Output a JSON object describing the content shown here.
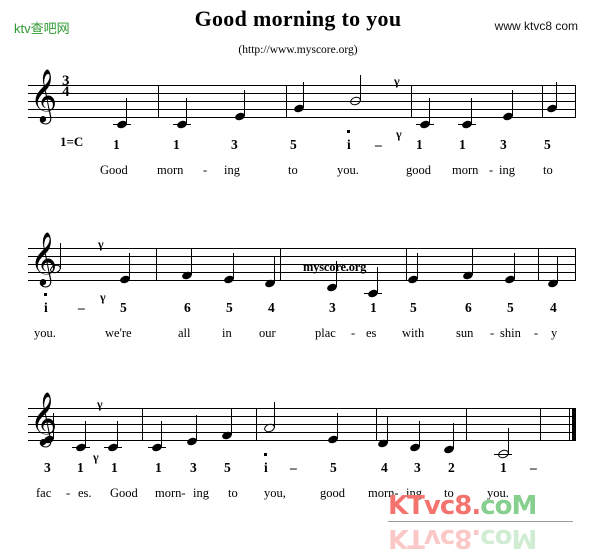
{
  "header": {
    "site_logo": "ktv查吧网",
    "title": "Good morning to you",
    "site_url": "www ktvc8 com",
    "subtitle": "(http://www.myscore.org)"
  },
  "score": {
    "clef_glyph": "𝄞",
    "time_signature_top": "3",
    "time_signature_bottom": "4",
    "key_label": "1=C",
    "watermark_staff": "myscore.org",
    "breath_mark": "γ",
    "dash": "–"
  },
  "watermark_bottom": {
    "part_red": "KTvc8.",
    "part_green": "coM"
  },
  "systems": [
    {
      "index": 1,
      "numbers": [
        "1",
        "1",
        "3",
        "5",
        "i",
        "–",
        "1",
        "1",
        "3",
        "5"
      ],
      "lyrics": [
        "Good",
        "morn",
        "-",
        "ing",
        "to",
        "you.",
        "good",
        "morn",
        "-",
        "ing",
        "to"
      ]
    },
    {
      "index": 2,
      "numbers": [
        "i",
        "–",
        "5",
        "6",
        "5",
        "4",
        "3",
        "1",
        "5",
        "6",
        "5",
        "4"
      ],
      "lyrics": [
        "you.",
        "we're",
        "all",
        "in",
        "our",
        "plac",
        "-",
        "es",
        "with",
        "sun",
        "-",
        "shin",
        "-",
        "y"
      ]
    },
    {
      "index": 3,
      "numbers": [
        "3",
        "1",
        "1",
        "1",
        "3",
        "5",
        "i",
        "–",
        "5",
        "4",
        "3",
        "2",
        "1",
        "–"
      ],
      "lyrics": [
        "fac",
        "-",
        "es.",
        "Good",
        "morn-",
        "ing",
        "to",
        "you,",
        "good",
        "morn-",
        "ing",
        "to",
        "you."
      ]
    }
  ],
  "chart_data": {
    "type": "table",
    "title": "Good morning to you",
    "key": "1=C",
    "time_signature": "3/4",
    "staves": [
      {
        "system": 1,
        "notes": [
          {
            "solfa": "1",
            "duration": "quarter",
            "octave": "low",
            "lyric": "Good"
          },
          {
            "solfa": "1",
            "duration": "quarter",
            "octave": "low",
            "lyric": "morn-"
          },
          {
            "solfa": "3",
            "duration": "quarter",
            "octave": "mid",
            "lyric": "ing"
          },
          {
            "solfa": "5",
            "duration": "quarter",
            "octave": "mid",
            "lyric": "to"
          },
          {
            "solfa": "i",
            "duration": "half",
            "octave": "high",
            "lyric": "you."
          },
          {
            "solfa": "1",
            "duration": "quarter",
            "octave": "low",
            "lyric": "good"
          },
          {
            "solfa": "1",
            "duration": "quarter",
            "octave": "low",
            "lyric": "morn-"
          },
          {
            "solfa": "3",
            "duration": "quarter",
            "octave": "mid",
            "lyric": "ing"
          },
          {
            "solfa": "5",
            "duration": "quarter",
            "octave": "mid",
            "lyric": "to"
          }
        ]
      },
      {
        "system": 2,
        "notes": [
          {
            "solfa": "i",
            "duration": "half",
            "octave": "high",
            "lyric": "you."
          },
          {
            "solfa": "5",
            "duration": "quarter",
            "octave": "mid",
            "lyric": "we're"
          },
          {
            "solfa": "6",
            "duration": "quarter",
            "octave": "mid",
            "lyric": "all"
          },
          {
            "solfa": "5",
            "duration": "quarter",
            "octave": "mid",
            "lyric": "in"
          },
          {
            "solfa": "4",
            "duration": "quarter",
            "octave": "mid",
            "lyric": "our"
          },
          {
            "solfa": "3",
            "duration": "quarter",
            "octave": "mid",
            "lyric": "plac-"
          },
          {
            "solfa": "1",
            "duration": "quarter",
            "octave": "low",
            "lyric": "es"
          },
          {
            "solfa": "5",
            "duration": "quarter",
            "octave": "mid",
            "lyric": "with"
          },
          {
            "solfa": "6",
            "duration": "quarter",
            "octave": "mid",
            "lyric": "sun-"
          },
          {
            "solfa": "5",
            "duration": "quarter",
            "octave": "mid",
            "lyric": "shin-"
          },
          {
            "solfa": "4",
            "duration": "quarter",
            "octave": "mid",
            "lyric": "y"
          }
        ]
      },
      {
        "system": 3,
        "notes": [
          {
            "solfa": "3",
            "duration": "quarter",
            "octave": "mid",
            "lyric": "fac-"
          },
          {
            "solfa": "1",
            "duration": "quarter",
            "octave": "low",
            "lyric": "es."
          },
          {
            "solfa": "1",
            "duration": "quarter",
            "octave": "low",
            "lyric": "Good"
          },
          {
            "solfa": "1",
            "duration": "quarter",
            "octave": "low",
            "lyric": "morn-"
          },
          {
            "solfa": "3",
            "duration": "quarter",
            "octave": "mid",
            "lyric": "ing"
          },
          {
            "solfa": "5",
            "duration": "quarter",
            "octave": "mid",
            "lyric": "to"
          },
          {
            "solfa": "i",
            "duration": "half",
            "octave": "high",
            "lyric": "you,"
          },
          {
            "solfa": "5",
            "duration": "quarter",
            "octave": "mid",
            "lyric": "good"
          },
          {
            "solfa": "4",
            "duration": "quarter",
            "octave": "mid",
            "lyric": "morn-"
          },
          {
            "solfa": "3",
            "duration": "quarter",
            "octave": "mid",
            "lyric": "ing"
          },
          {
            "solfa": "2",
            "duration": "quarter",
            "octave": "mid",
            "lyric": "to"
          },
          {
            "solfa": "1",
            "duration": "half",
            "octave": "low",
            "lyric": "you."
          }
        ]
      }
    ]
  }
}
